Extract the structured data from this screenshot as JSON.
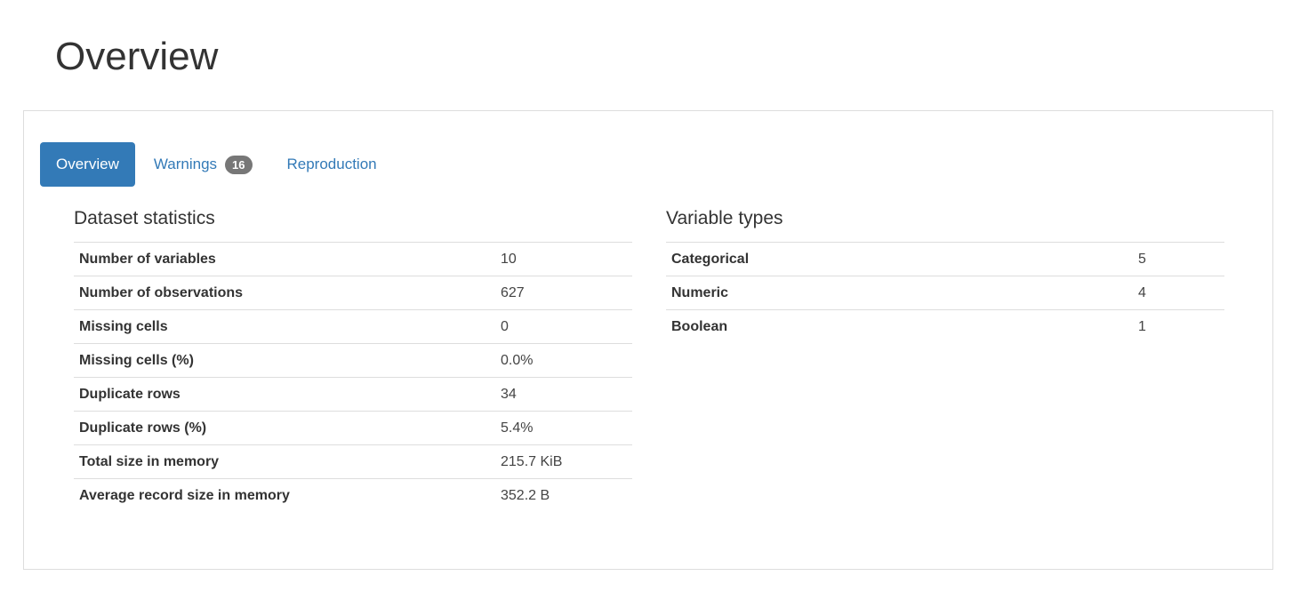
{
  "page": {
    "title": "Overview"
  },
  "tabs": [
    {
      "label": "Overview",
      "active": true
    },
    {
      "label": "Warnings",
      "badge": "16",
      "active": false
    },
    {
      "label": "Reproduction",
      "active": false
    }
  ],
  "dataset_statistics": {
    "title": "Dataset statistics",
    "rows": [
      {
        "label": "Number of variables",
        "value": "10"
      },
      {
        "label": "Number of observations",
        "value": "627"
      },
      {
        "label": "Missing cells",
        "value": "0"
      },
      {
        "label": "Missing cells (%)",
        "value": "0.0%"
      },
      {
        "label": "Duplicate rows",
        "value": "34"
      },
      {
        "label": "Duplicate rows (%)",
        "value": "5.4%"
      },
      {
        "label": "Total size in memory",
        "value": "215.7 KiB"
      },
      {
        "label": "Average record size in memory",
        "value": "352.2 B"
      }
    ]
  },
  "variable_types": {
    "title": "Variable types",
    "rows": [
      {
        "label": "Categorical",
        "value": "5"
      },
      {
        "label": "Numeric",
        "value": "4"
      },
      {
        "label": "Boolean",
        "value": "1"
      }
    ]
  },
  "colors": {
    "accent": "#337ab7",
    "badge": "#777777",
    "border": "#dddddd",
    "text": "#333333"
  }
}
